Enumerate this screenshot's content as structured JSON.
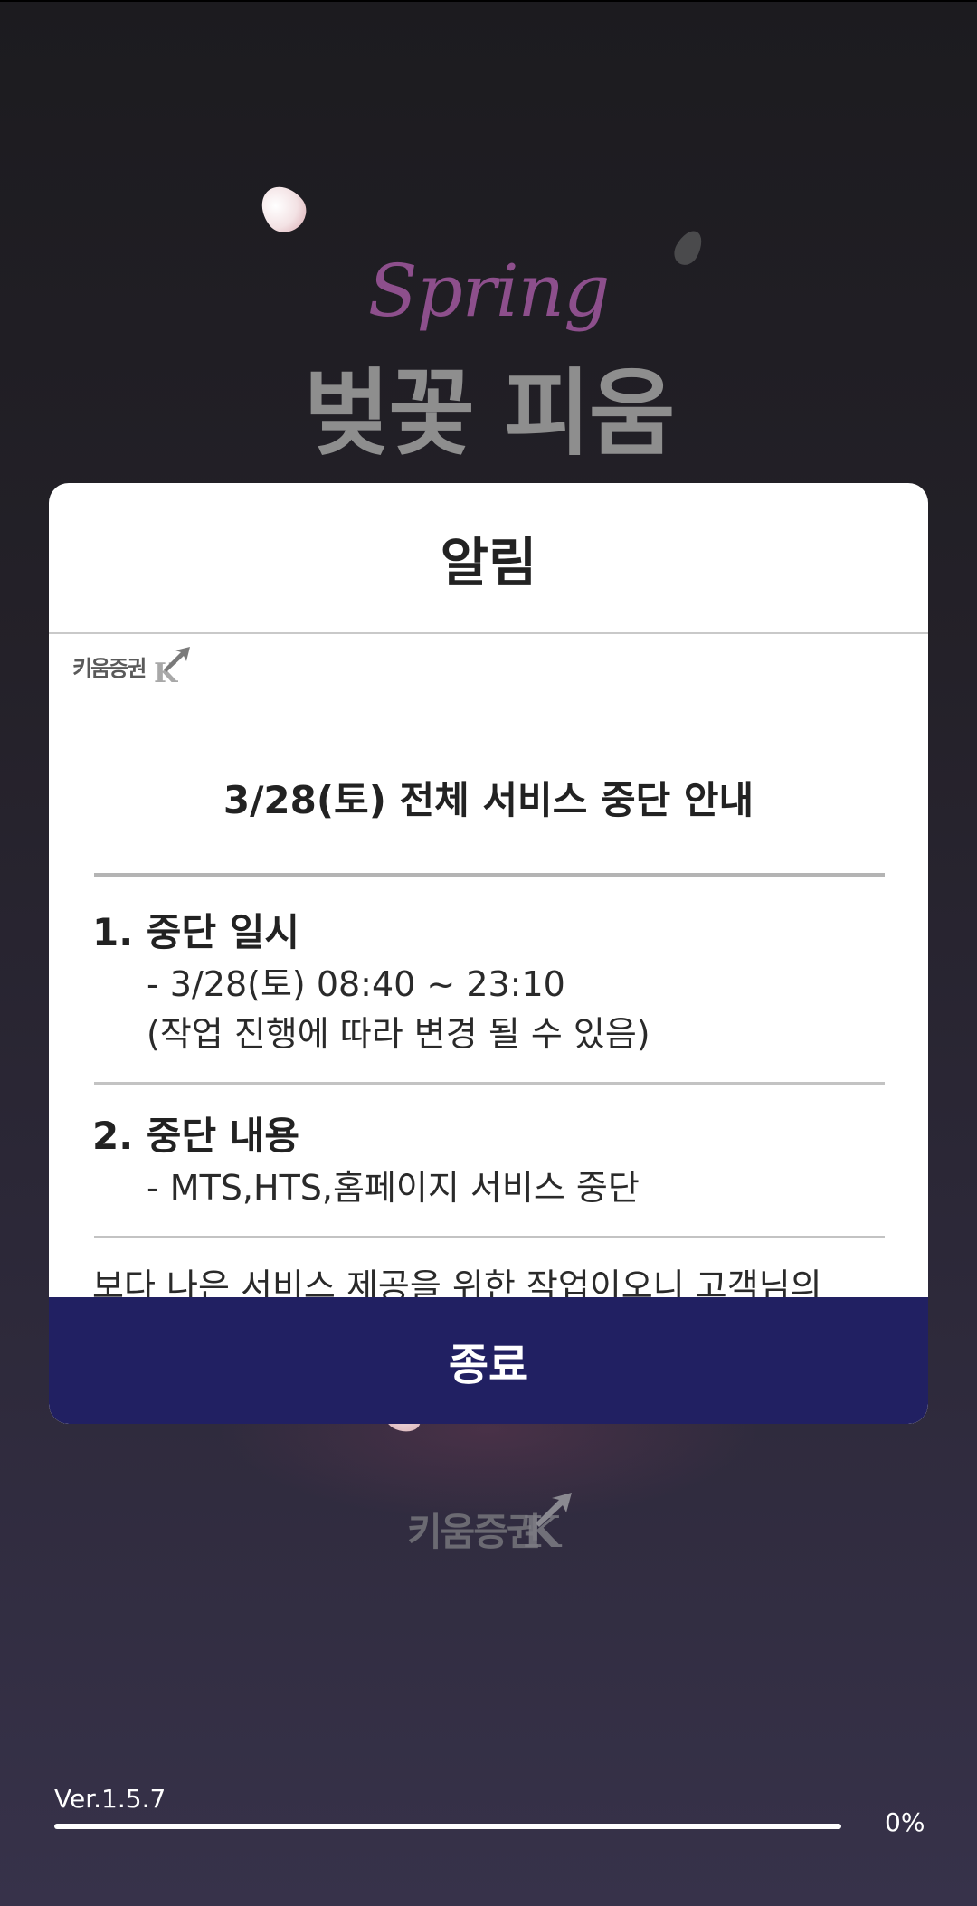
{
  "background": {
    "spring_text": "Spring",
    "headline": "벚꽃 피움",
    "logo_text": "키움증권"
  },
  "dialog": {
    "title": "알림",
    "logo_text": "키움증권",
    "notice_title": "3/28(토) 전체 서비스 중단 안내",
    "sections": [
      {
        "heading": "1. 중단 일시",
        "lines": [
          "- 3/28(토) 08:40 ~ 23:10",
          "(작업 진행에 따라 변경 될 수 있음)"
        ]
      },
      {
        "heading": "2. 중단 내용",
        "lines": [
          "- MTS,HTS,홈페이지 서비스 중단"
        ]
      }
    ],
    "closing_text": "보다 나은 서비스 제공을 위한 작업이오니 고객님의",
    "close_button_label": "종료"
  },
  "footer": {
    "version": "Ver.1.5.7",
    "progress_percent_label": "0%",
    "progress_value": 0
  },
  "colors": {
    "close_button": "#212062",
    "spring_text": "#8d4f8c"
  }
}
